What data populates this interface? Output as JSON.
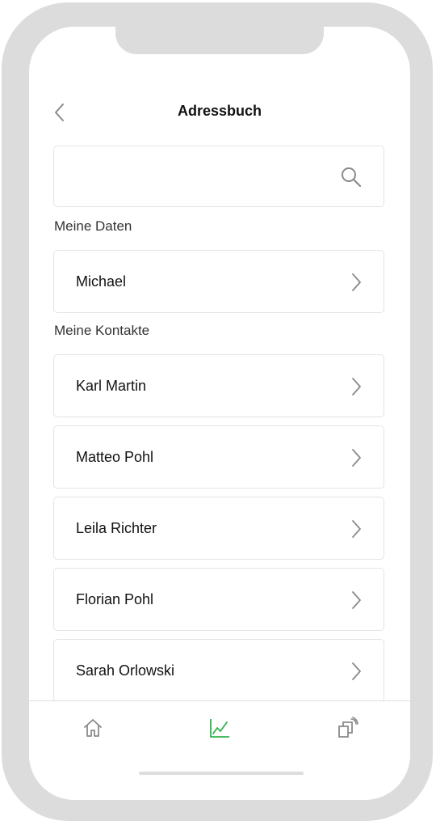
{
  "header": {
    "title": "Adressbuch",
    "back_icon": "chevron-left-icon"
  },
  "search": {
    "value": "",
    "placeholder": "",
    "icon": "search-icon"
  },
  "my_data": {
    "section_label": "Meine Daten",
    "items": [
      {
        "label": "Michael"
      }
    ]
  },
  "contacts": {
    "section_label": "Meine Kontakte",
    "items": [
      {
        "label": "Karl Martin"
      },
      {
        "label": "Matteo Pohl"
      },
      {
        "label": "Leila Richter"
      },
      {
        "label": "Florian Pohl"
      },
      {
        "label": "Sarah Orlowski"
      }
    ]
  },
  "bottom_nav": {
    "items": [
      {
        "icon": "home-icon",
        "active": false
      },
      {
        "icon": "chart-icon",
        "active": true
      },
      {
        "icon": "device-signal-icon",
        "active": false
      }
    ]
  },
  "colors": {
    "accent": "#2db34a",
    "icon_inactive": "#8a8a8a",
    "border": "#e4e4e4",
    "frame": "#dcdcdc"
  }
}
